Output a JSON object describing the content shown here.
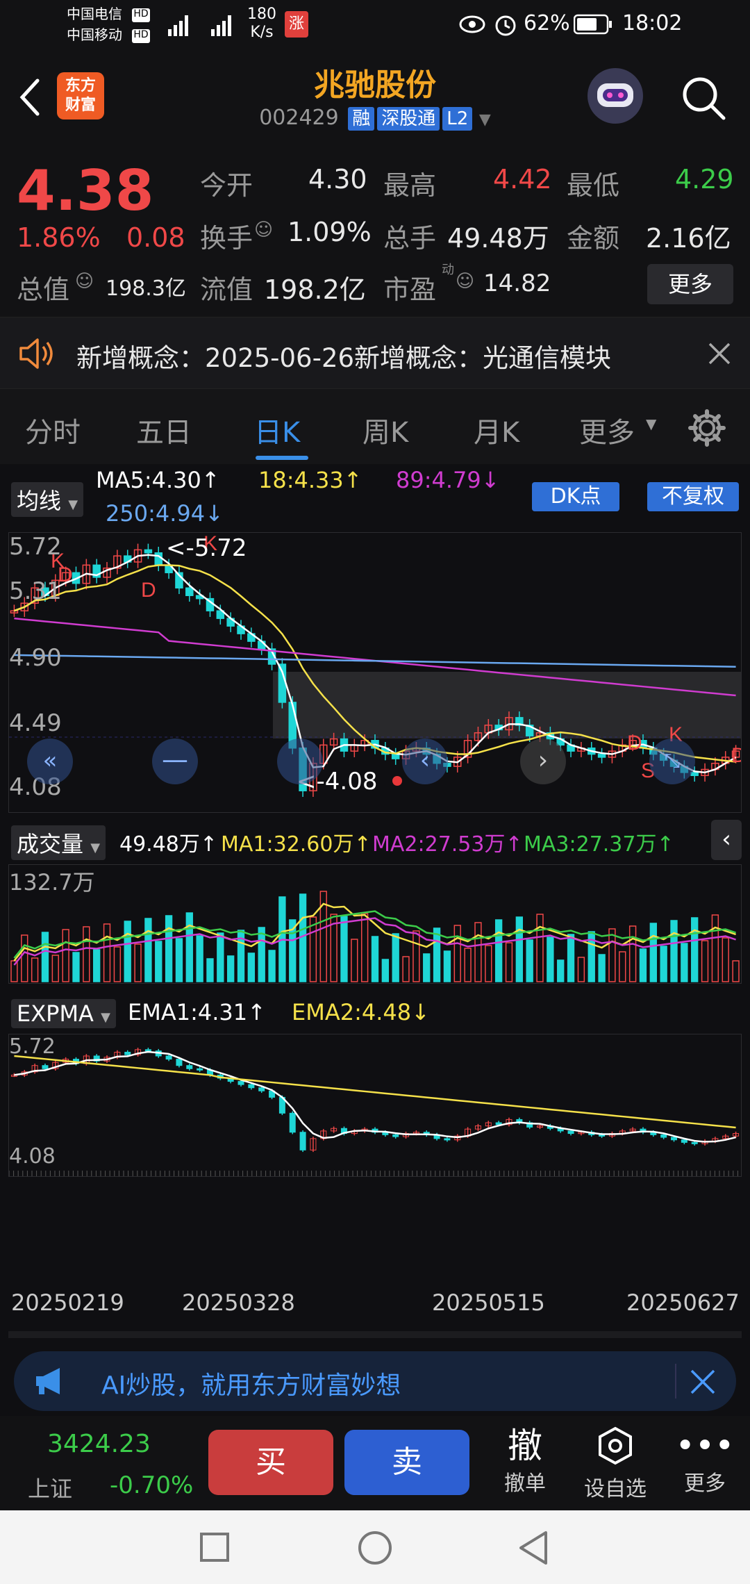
{
  "status_bar": {
    "carrier1": "中国电信",
    "carrier2": "中国移动",
    "speed_value": "180",
    "speed_unit": "K/s",
    "battery": "62%",
    "time": "18:02"
  },
  "header": {
    "logo_line1": "东方",
    "logo_line2": "财富",
    "stock_name": "兆驰股份",
    "stock_code": "002429",
    "tag_rong": "融",
    "tag_sgt": "深股通",
    "tag_l2": "L2"
  },
  "quote": {
    "price": "4.38",
    "change_pct": "1.86%",
    "change_amt": "0.08",
    "open_label": "今开",
    "open": "4.30",
    "high_label": "最高",
    "high": "4.42",
    "low_label": "最低",
    "low": "4.29",
    "turnover_label": "换手",
    "turnover": "1.09%",
    "volume_label": "总手",
    "volume": "49.48万",
    "amount_label": "金额",
    "amount": "2.16亿",
    "mcap_label": "总值",
    "mcap": "198.3亿",
    "float_label": "流值",
    "float_cap": "198.2亿",
    "pe_label": "市盈",
    "pe_sup": "动",
    "pe": "14.82",
    "more": "更多"
  },
  "notice": {
    "text": "新增概念：2025-06-26新增概念：光通信模块"
  },
  "tabs": [
    "分时",
    "五日",
    "日K",
    "周K",
    "月K",
    "更多"
  ],
  "kline": {
    "indicator": "均线",
    "ma5": "MA5:4.30↑",
    "ma18": "18:4.33↑",
    "ma89": "89:4.79↓",
    "ma250": "250:4.94↓",
    "dk_button": "DK点",
    "fq_button": "不复权",
    "y_labels": [
      "5.72",
      "5.31",
      "4.90",
      "4.49",
      "4.08"
    ],
    "max_label": "<-5.72",
    "min_label": "<-4.08",
    "signals": [
      "K",
      "D",
      "D",
      "K",
      "D",
      "K",
      "S",
      "D"
    ]
  },
  "volume": {
    "indicator": "成交量",
    "vol": "49.48万↑",
    "ma1": "MA1:32.60万↑",
    "ma2": "MA2:27.53万↑",
    "ma3": "MA3:27.37万↑",
    "y_top": "132.7万"
  },
  "expma": {
    "indicator": "EXPMA",
    "ema1": "EMA1:4.31↑",
    "ema2": "EMA2:4.48↓",
    "y_top": "5.72",
    "y_bottom": "4.08"
  },
  "dates": [
    "20250219",
    "20250328",
    "20250515",
    "20250627"
  ],
  "ad": {
    "text": "AI炒股，就用东方财富妙想"
  },
  "bottom": {
    "index_value": "3424.23",
    "index_name": "上证",
    "index_change": "-0.70%",
    "buy": "买",
    "sell": "卖",
    "cancel_icon_char": "撤",
    "cancel": "撤单",
    "watch": "设自选",
    "more": "更多"
  },
  "colors": {
    "up": "#f04848",
    "down": "#1fd6d6",
    "ma5": "#ffffff",
    "ma18": "#f5e14a",
    "ma89": "#d03cd0",
    "ma250": "#6aa8f0",
    "accent": "#f3a623"
  }
}
